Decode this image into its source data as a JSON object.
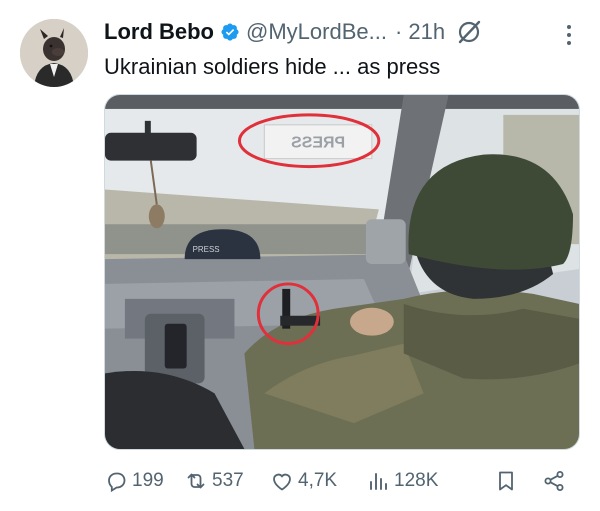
{
  "tweet": {
    "author_name": "Lord Bebo",
    "handle": "@MyLordBe...",
    "time": "· 21h",
    "text": "Ukrainian soldiers hide ... as press",
    "image_sign_text": "PRESS",
    "image_helmet_text": "PRESS",
    "actions": {
      "replies": "199",
      "reposts": "537",
      "likes": "4,7K",
      "views": "128K"
    }
  },
  "icons": {
    "verified": "verified-badge-icon",
    "grok": "grok-icon",
    "more": "more-options-icon",
    "reply": "reply-icon",
    "repost": "repost-icon",
    "like": "heart-icon",
    "views": "views-icon",
    "bookmark": "bookmark-icon",
    "share": "share-icon"
  },
  "colors": {
    "verified": "#1d9bf0",
    "secondary_text": "#536471",
    "annotation_circle": "#e0303a"
  }
}
